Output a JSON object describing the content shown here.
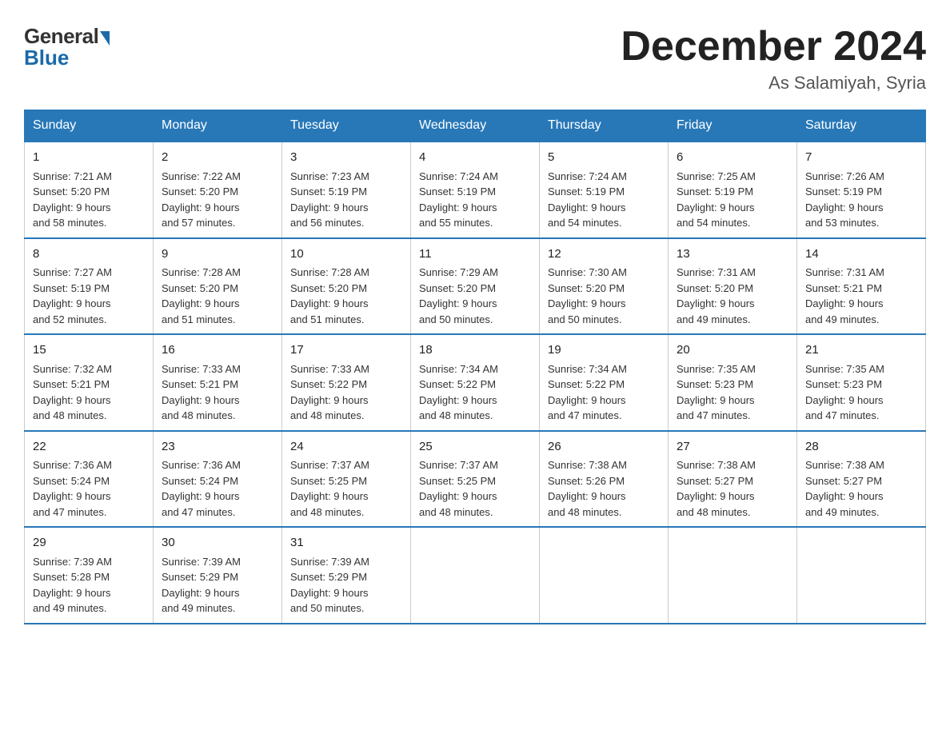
{
  "logo": {
    "general": "General",
    "blue": "Blue"
  },
  "title": {
    "month_year": "December 2024",
    "location": "As Salamiyah, Syria"
  },
  "days_of_week": [
    "Sunday",
    "Monday",
    "Tuesday",
    "Wednesday",
    "Thursday",
    "Friday",
    "Saturday"
  ],
  "weeks": [
    [
      {
        "day": "1",
        "sunrise": "7:21 AM",
        "sunset": "5:20 PM",
        "daylight": "9 hours and 58 minutes."
      },
      {
        "day": "2",
        "sunrise": "7:22 AM",
        "sunset": "5:20 PM",
        "daylight": "9 hours and 57 minutes."
      },
      {
        "day": "3",
        "sunrise": "7:23 AM",
        "sunset": "5:19 PM",
        "daylight": "9 hours and 56 minutes."
      },
      {
        "day": "4",
        "sunrise": "7:24 AM",
        "sunset": "5:19 PM",
        "daylight": "9 hours and 55 minutes."
      },
      {
        "day": "5",
        "sunrise": "7:24 AM",
        "sunset": "5:19 PM",
        "daylight": "9 hours and 54 minutes."
      },
      {
        "day": "6",
        "sunrise": "7:25 AM",
        "sunset": "5:19 PM",
        "daylight": "9 hours and 54 minutes."
      },
      {
        "day": "7",
        "sunrise": "7:26 AM",
        "sunset": "5:19 PM",
        "daylight": "9 hours and 53 minutes."
      }
    ],
    [
      {
        "day": "8",
        "sunrise": "7:27 AM",
        "sunset": "5:19 PM",
        "daylight": "9 hours and 52 minutes."
      },
      {
        "day": "9",
        "sunrise": "7:28 AM",
        "sunset": "5:20 PM",
        "daylight": "9 hours and 51 minutes."
      },
      {
        "day": "10",
        "sunrise": "7:28 AM",
        "sunset": "5:20 PM",
        "daylight": "9 hours and 51 minutes."
      },
      {
        "day": "11",
        "sunrise": "7:29 AM",
        "sunset": "5:20 PM",
        "daylight": "9 hours and 50 minutes."
      },
      {
        "day": "12",
        "sunrise": "7:30 AM",
        "sunset": "5:20 PM",
        "daylight": "9 hours and 50 minutes."
      },
      {
        "day": "13",
        "sunrise": "7:31 AM",
        "sunset": "5:20 PM",
        "daylight": "9 hours and 49 minutes."
      },
      {
        "day": "14",
        "sunrise": "7:31 AM",
        "sunset": "5:21 PM",
        "daylight": "9 hours and 49 minutes."
      }
    ],
    [
      {
        "day": "15",
        "sunrise": "7:32 AM",
        "sunset": "5:21 PM",
        "daylight": "9 hours and 48 minutes."
      },
      {
        "day": "16",
        "sunrise": "7:33 AM",
        "sunset": "5:21 PM",
        "daylight": "9 hours and 48 minutes."
      },
      {
        "day": "17",
        "sunrise": "7:33 AM",
        "sunset": "5:22 PM",
        "daylight": "9 hours and 48 minutes."
      },
      {
        "day": "18",
        "sunrise": "7:34 AM",
        "sunset": "5:22 PM",
        "daylight": "9 hours and 48 minutes."
      },
      {
        "day": "19",
        "sunrise": "7:34 AM",
        "sunset": "5:22 PM",
        "daylight": "9 hours and 47 minutes."
      },
      {
        "day": "20",
        "sunrise": "7:35 AM",
        "sunset": "5:23 PM",
        "daylight": "9 hours and 47 minutes."
      },
      {
        "day": "21",
        "sunrise": "7:35 AM",
        "sunset": "5:23 PM",
        "daylight": "9 hours and 47 minutes."
      }
    ],
    [
      {
        "day": "22",
        "sunrise": "7:36 AM",
        "sunset": "5:24 PM",
        "daylight": "9 hours and 47 minutes."
      },
      {
        "day": "23",
        "sunrise": "7:36 AM",
        "sunset": "5:24 PM",
        "daylight": "9 hours and 47 minutes."
      },
      {
        "day": "24",
        "sunrise": "7:37 AM",
        "sunset": "5:25 PM",
        "daylight": "9 hours and 48 minutes."
      },
      {
        "day": "25",
        "sunrise": "7:37 AM",
        "sunset": "5:25 PM",
        "daylight": "9 hours and 48 minutes."
      },
      {
        "day": "26",
        "sunrise": "7:38 AM",
        "sunset": "5:26 PM",
        "daylight": "9 hours and 48 minutes."
      },
      {
        "day": "27",
        "sunrise": "7:38 AM",
        "sunset": "5:27 PM",
        "daylight": "9 hours and 48 minutes."
      },
      {
        "day": "28",
        "sunrise": "7:38 AM",
        "sunset": "5:27 PM",
        "daylight": "9 hours and 49 minutes."
      }
    ],
    [
      {
        "day": "29",
        "sunrise": "7:39 AM",
        "sunset": "5:28 PM",
        "daylight": "9 hours and 49 minutes."
      },
      {
        "day": "30",
        "sunrise": "7:39 AM",
        "sunset": "5:29 PM",
        "daylight": "9 hours and 49 minutes."
      },
      {
        "day": "31",
        "sunrise": "7:39 AM",
        "sunset": "5:29 PM",
        "daylight": "9 hours and 50 minutes."
      },
      null,
      null,
      null,
      null
    ]
  ],
  "labels": {
    "sunrise": "Sunrise:",
    "sunset": "Sunset:",
    "daylight": "Daylight:"
  }
}
